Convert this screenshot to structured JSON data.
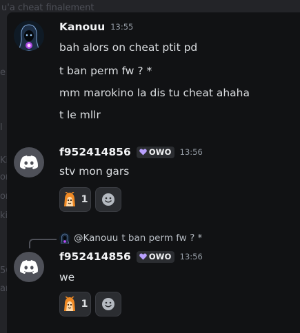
{
  "background": {
    "top_text": "u'a cheat finalement",
    "fragments": [
      "e",
      "l",
      "Ki",
      "or",
      "on",
      "ki",
      "56",
      "ar"
    ]
  },
  "messages": [
    {
      "username": "Kanouu",
      "time": "13:55",
      "avatar_icon": "hooded-figure-avatar-icon",
      "lines": [
        "bah alors on cheat ptit pd",
        "t ban perm fw ? *",
        "mm marokino la dis tu cheat ahaha",
        "t le mllr"
      ]
    },
    {
      "username": "f952414856",
      "tag": "OWO",
      "time": "13:56",
      "avatar_icon": "discord-logo-icon",
      "lines": [
        "stv mon gars"
      ],
      "reaction": {
        "icon": "orange-cartoon-emoji-icon",
        "count": "1"
      }
    },
    {
      "reply": {
        "mention": "@Kanouu",
        "text": "t ban perm fw ? *"
      },
      "username": "f952414856",
      "tag": "OWO",
      "time": "13:56",
      "avatar_icon": "discord-logo-icon",
      "lines": [
        "we"
      ],
      "reaction": {
        "icon": "orange-cartoon-emoji-icon",
        "count": "1"
      }
    }
  ],
  "colors": {
    "panel": "#111214",
    "username": "#f2f3f5",
    "timestamp": "#949ba4",
    "tag_heart": "#b9a0ff",
    "discord_avatar": "#4e5058"
  }
}
